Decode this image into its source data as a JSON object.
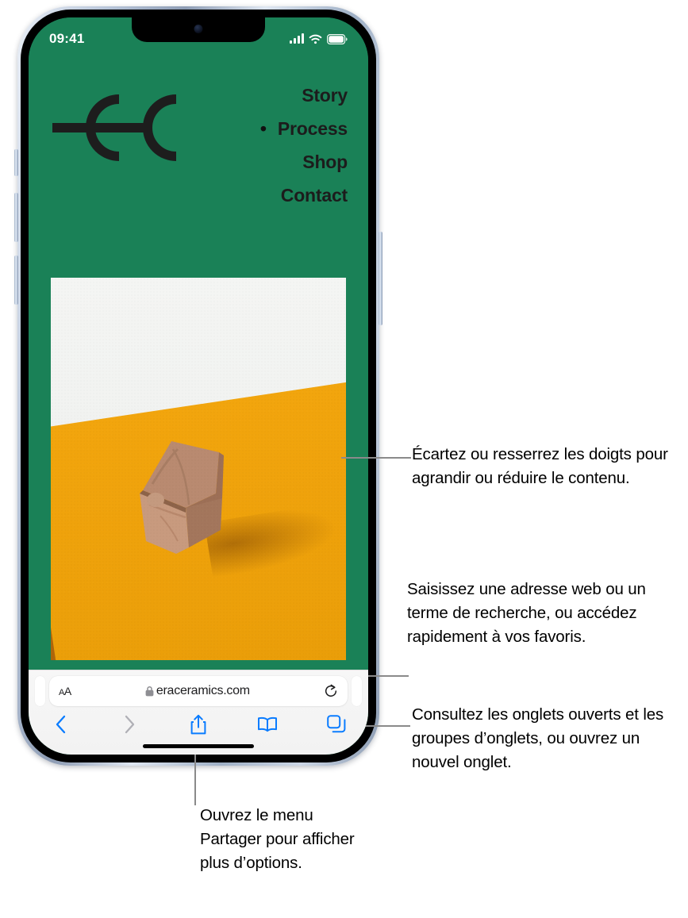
{
  "status_bar": {
    "time": "09:41",
    "cellular_icon": "cellular-signal-icon",
    "wifi_icon": "wifi-icon",
    "battery_icon": "battery-icon"
  },
  "website": {
    "brand_color": "#1a8157",
    "logo_name": "era-ceramics-logo",
    "nav": [
      {
        "label": "Story",
        "current": false
      },
      {
        "label": "Process",
        "current": true
      },
      {
        "label": "Shop",
        "current": false
      },
      {
        "label": "Contact",
        "current": false
      }
    ],
    "hero_image_alt": "clay-block-photo"
  },
  "browser": {
    "text_size_button": {
      "small": "A",
      "large": "A",
      "name": "text-size-button"
    },
    "lock_icon": "lock-icon",
    "url": "eraceramics.com",
    "reload_icon": "reload-icon",
    "toolbar": [
      {
        "name": "back-button",
        "icon": "chevron-left-icon",
        "enabled": true
      },
      {
        "name": "forward-button",
        "icon": "chevron-right-icon",
        "enabled": false
      },
      {
        "name": "share-button",
        "icon": "share-icon",
        "enabled": true
      },
      {
        "name": "bookmarks-button",
        "icon": "book-icon",
        "enabled": true
      },
      {
        "name": "tabs-button",
        "icon": "tabs-icon",
        "enabled": true
      }
    ],
    "home_indicator": "home-indicator"
  },
  "callouts": {
    "zoom": "Écartez ou resserrez les doigts pour agrandir ou réduire le contenu.",
    "address": "Saisissez une adresse web ou un terme de recherche, ou accédez rapidement à vos favoris.",
    "tabs": "Consultez les onglets ouverts et les groupes d’onglets, ou ouvrez un nouvel onglet.",
    "share": "Ouvrez le menu Partager pour afficher plus d’options."
  },
  "colors": {
    "accent_blue": "#0a7cff",
    "disabled_gray": "#a8a8ae",
    "green": "#1a8157",
    "orange": "#f0a30c",
    "dark_orange": "#b06a0a",
    "clay": "#c08a6e"
  }
}
